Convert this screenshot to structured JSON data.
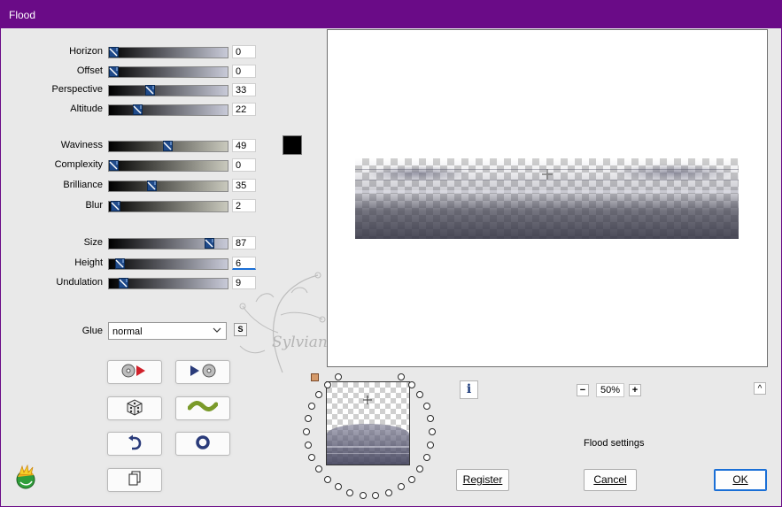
{
  "window": {
    "title": "Flood"
  },
  "params_group1": [
    {
      "id": "horizon",
      "label": "Horizon",
      "value": "0",
      "level": 0
    },
    {
      "id": "offset",
      "label": "Offset",
      "value": "0",
      "level": 0
    },
    {
      "id": "perspective",
      "label": "Perspective",
      "value": "33",
      "level": 33
    },
    {
      "id": "altitude",
      "label": "Altitude",
      "value": "22",
      "level": 22
    }
  ],
  "params_group2": [
    {
      "id": "waviness",
      "label": "Waviness",
      "value": "49",
      "level": 49
    },
    {
      "id": "complexity",
      "label": "Complexity",
      "value": "0",
      "level": 0
    },
    {
      "id": "brilliance",
      "label": "Brilliance",
      "value": "35",
      "level": 35
    },
    {
      "id": "blur",
      "label": "Blur",
      "value": "2",
      "level": 2
    }
  ],
  "params_group3": [
    {
      "id": "size",
      "label": "Size",
      "value": "87",
      "level": 87
    },
    {
      "id": "height",
      "label": "Height",
      "value": "6",
      "level": 6
    },
    {
      "id": "undulation",
      "label": "Undulation",
      "value": "9",
      "level": 9
    }
  ],
  "glue": {
    "label": "Glue",
    "selected": "normal",
    "lock_label": "S"
  },
  "color_swatch": "#000000",
  "zoom": {
    "minus": "−",
    "value": "50%",
    "plus": "+"
  },
  "collapse_label": "^",
  "info_label": "i",
  "status_text": "Flood settings",
  "buttons": {
    "register": "Register",
    "cancel": "Cancel",
    "ok": "OK"
  },
  "watermark": {
    "text": "Sylviane"
  },
  "colors": {
    "title_bar": "#6a0b87",
    "slider_group1": "#c8cad8",
    "slider_group2": "#c9c9bd",
    "slider_group3": "#c8cad8"
  }
}
